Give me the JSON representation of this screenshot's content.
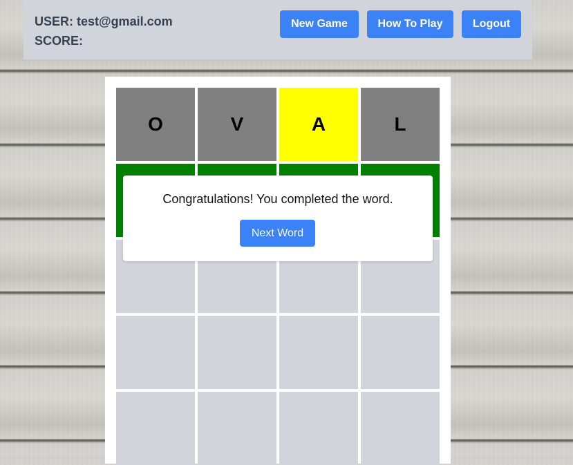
{
  "header": {
    "user_label": "USER: test@gmail.com",
    "score_label": "SCORE:",
    "buttons": {
      "new_game": "New Game",
      "how_to_play": "How To Play",
      "logout": "Logout"
    }
  },
  "board": {
    "rows": [
      [
        {
          "letter": "O",
          "state": "gray"
        },
        {
          "letter": "V",
          "state": "gray"
        },
        {
          "letter": "A",
          "state": "yellow"
        },
        {
          "letter": "L",
          "state": "gray"
        }
      ],
      [
        {
          "letter": "",
          "state": "green"
        },
        {
          "letter": "",
          "state": "green"
        },
        {
          "letter": "",
          "state": "green"
        },
        {
          "letter": "",
          "state": "green"
        }
      ],
      [
        {
          "letter": "",
          "state": "empty"
        },
        {
          "letter": "",
          "state": "empty"
        },
        {
          "letter": "",
          "state": "empty"
        },
        {
          "letter": "",
          "state": "empty"
        }
      ],
      [
        {
          "letter": "",
          "state": "empty"
        },
        {
          "letter": "",
          "state": "empty"
        },
        {
          "letter": "",
          "state": "empty"
        },
        {
          "letter": "",
          "state": "empty"
        }
      ],
      [
        {
          "letter": "",
          "state": "empty"
        },
        {
          "letter": "",
          "state": "empty"
        },
        {
          "letter": "",
          "state": "empty"
        },
        {
          "letter": "",
          "state": "empty"
        }
      ]
    ],
    "colors": {
      "gray": "#808080",
      "yellow": "#ffff00",
      "green": "#008000",
      "empty": "#d1d5db"
    }
  },
  "modal": {
    "message": "Congratulations! You completed the word.",
    "button_label": "Next Word"
  },
  "theme": {
    "accent": "#3b82f6",
    "header_bg": "#d1d5db"
  }
}
